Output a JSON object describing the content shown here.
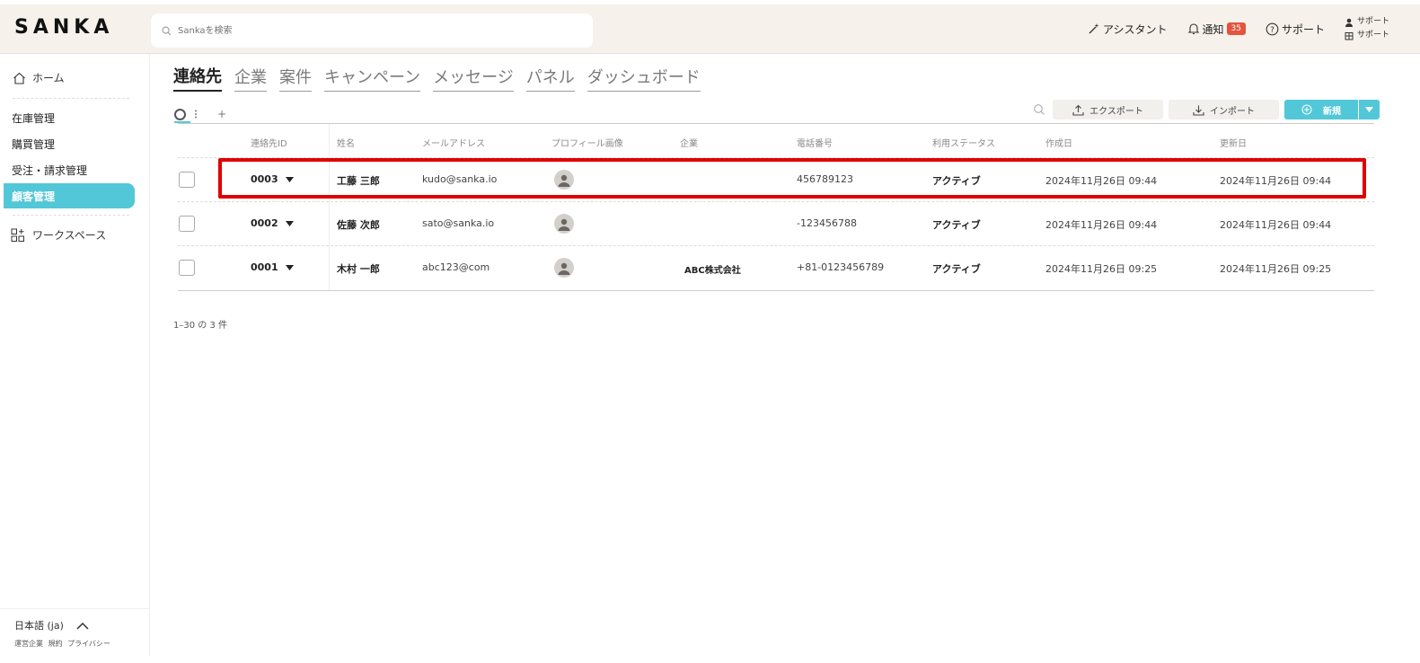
{
  "header": {
    "logo": "SANKA",
    "search_placeholder": "Sankaを検索",
    "assistant_label": "アシスタント",
    "notification_label": "通知",
    "notification_count": "35",
    "support_label": "サポート",
    "account_line1": "サポート",
    "account_line2": "サポート"
  },
  "sidebar": {
    "home": "ホーム",
    "items": [
      "在庫管理",
      "購買管理",
      "受注・請求管理",
      "顧客管理"
    ],
    "workspace": "ワークスペース",
    "language": "日本語 (ja)",
    "footer_links": [
      "運営企業",
      "規約",
      "プライバシー"
    ]
  },
  "tabs": [
    "連絡先",
    "企業",
    "案件",
    "キャンペーン",
    "メッセージ",
    "パネル",
    "ダッシュボード"
  ],
  "toolbar": {
    "add_view": "+",
    "export_label": "エクスポート",
    "import_label": "インポート",
    "new_label": "新規"
  },
  "table": {
    "columns": [
      "連絡先ID",
      "姓名",
      "メールアドレス",
      "プロフィール画像",
      "企業",
      "電話番号",
      "利用ステータス",
      "作成日",
      "更新日"
    ],
    "rows": [
      {
        "id": "0003",
        "name": "工藤 三郎",
        "email": "kudo@sanka.io",
        "company": "",
        "phone": "456789123",
        "status": "アクティブ",
        "created": "2024年11月26日 09:44",
        "updated": "2024年11月26日 09:44"
      },
      {
        "id": "0002",
        "name": "佐藤 次郎",
        "email": "sato@sanka.io",
        "company": "",
        "phone": "-123456788",
        "status": "アクティブ",
        "created": "2024年11月26日 09:44",
        "updated": "2024年11月26日 09:44"
      },
      {
        "id": "0001",
        "name": "木村 一郎",
        "email": "abc123@com",
        "company": "ABC株式会社",
        "phone": "+81-0123456789",
        "status": "アクティブ",
        "created": "2024年11月26日 09:25",
        "updated": "2024年11月26日 09:25"
      }
    ]
  },
  "pagination": "1–30 の 3 件",
  "colors": {
    "accent": "#52c7d8",
    "header_bg": "#f6f1ea",
    "badge": "#e5533d",
    "highlight": "#e00000"
  }
}
